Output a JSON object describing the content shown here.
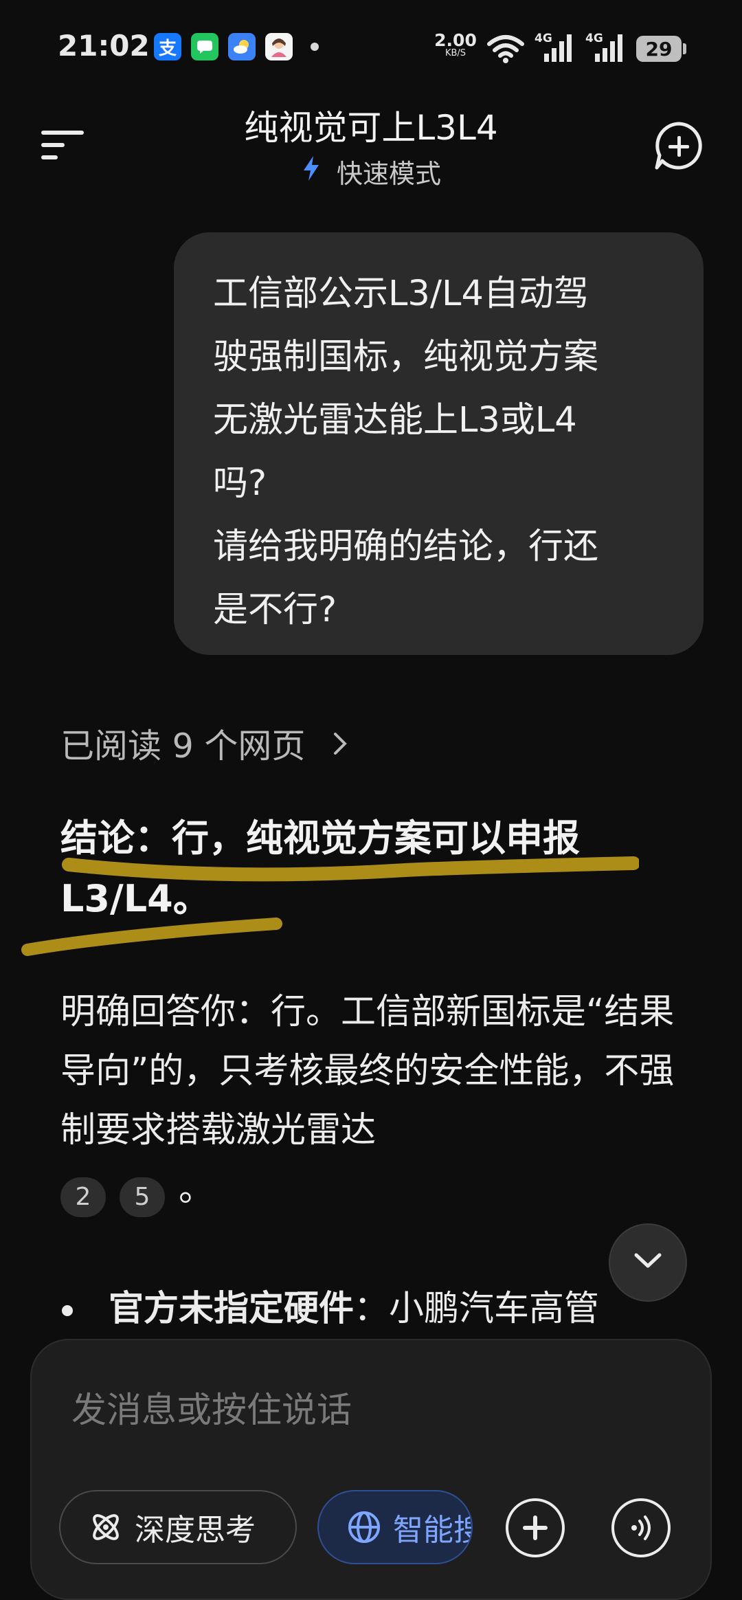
{
  "status_bar": {
    "time": "21:02",
    "notification_icons": [
      {
        "name": "alipay-icon",
        "glyph": "支",
        "color": "#1677ff"
      },
      {
        "name": "messages-icon",
        "glyph": "",
        "color": "#22c55e"
      },
      {
        "name": "weather-icon",
        "glyph": "",
        "color": "#3b82f6"
      },
      {
        "name": "avatar-app-icon",
        "glyph": "",
        "color": "#f5f5f5"
      }
    ],
    "net_speed_value": "2.00",
    "net_speed_unit": "KB/S",
    "signal_label_1": "4G",
    "signal_label_2": "4G",
    "battery": "29"
  },
  "header": {
    "title": "纯视觉可上L3L4",
    "mode_label": "快速模式",
    "mode_icon": "lightning-icon",
    "menu_icon": "menu-icon",
    "new_chat_icon": "new-chat-icon"
  },
  "user_message": {
    "text": "工信部公示L3/L4自动驾\n驶强制国标，纯视觉方案\n无激光雷达能上L3或L4\n吗?\n请给我明确的结论，行还\n是不行?"
  },
  "answer": {
    "read_pages": "已阅读 9 个网页",
    "conclusion": "结论：行，纯视觉方案可以申报L3/L4。",
    "paragraph": "明确回答你：行。工信部新国标是“结果导向”的，只考核最终的安全性能，不强制要求搭载激光雷达",
    "citations": [
      "2",
      "5"
    ],
    "paragraph_end": "。",
    "bullet_bold": "官方未指定硬件",
    "bullet_rest": "：小鹏汽车高管"
  },
  "input": {
    "placeholder": "发消息或按住说话",
    "deep_think_label": "深度思考",
    "smart_search_label": "智能搜索",
    "accent_color": "#7fa6ff",
    "highlight_color": "#c9a51a"
  }
}
